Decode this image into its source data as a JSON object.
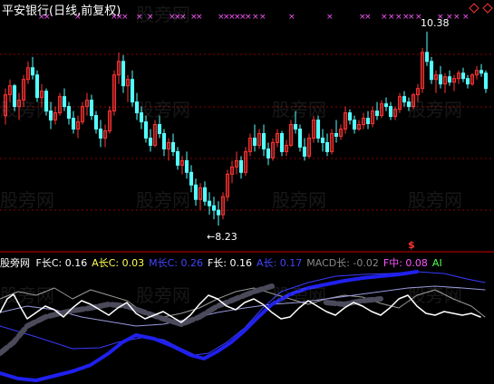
{
  "title": "平安银行(日线,前复权)",
  "annotations": {
    "high": "10.38",
    "low": "8.23",
    "low_arrow": "←8.23"
  },
  "watermark": "股旁网",
  "signal_mark": "$",
  "legend": {
    "prefix": "股旁网",
    "items": [
      {
        "label": "F长C:",
        "value": "0.16",
        "color": "#ffffff"
      },
      {
        "label": "A长C:",
        "value": "0.03",
        "color": "#ffff55"
      },
      {
        "label": "M长C:",
        "value": "0.26",
        "color": "#4444ff"
      },
      {
        "label": "F长:",
        "value": "0.16",
        "color": "#ffffff"
      },
      {
        "label": "A长:",
        "value": "0.17",
        "color": "#4444ff"
      },
      {
        "label": "MACD长:",
        "value": "-0.02",
        "color": "#888888"
      },
      {
        "label": "F中:",
        "value": "0.08",
        "color": "#ff55ff"
      },
      {
        "label": "AI",
        "value": "",
        "color": "#55ff55"
      }
    ]
  },
  "colors": {
    "up": "#ff3333",
    "down": "#55ffff",
    "grid": "#8b0000",
    "marker": "#ff55ff",
    "divider": "#cc0000"
  },
  "chart_data": {
    "type": "candlestick",
    "y_range": [
      8.0,
      10.55
    ],
    "candles": [
      [
        9.45,
        9.75,
        9.35,
        9.68
      ],
      [
        9.68,
        9.85,
        9.6,
        9.78
      ],
      [
        9.78,
        9.8,
        9.5,
        9.55
      ],
      [
        9.55,
        9.7,
        9.4,
        9.62
      ],
      [
        9.62,
        9.9,
        9.55,
        9.85
      ],
      [
        9.85,
        10.05,
        9.8,
        9.98
      ],
      [
        9.98,
        10.1,
        9.85,
        9.9
      ],
      [
        9.9,
        9.95,
        9.6,
        9.65
      ],
      [
        9.65,
        9.8,
        9.55,
        9.72
      ],
      [
        9.72,
        9.75,
        9.45,
        9.5
      ],
      [
        9.5,
        9.6,
        9.3,
        9.4
      ],
      [
        9.4,
        9.55,
        9.35,
        9.48
      ],
      [
        9.48,
        9.7,
        9.45,
        9.66
      ],
      [
        9.66,
        9.75,
        9.5,
        9.55
      ],
      [
        9.55,
        9.6,
        9.35,
        9.42
      ],
      [
        9.42,
        9.5,
        9.25,
        9.3
      ],
      [
        9.3,
        9.45,
        9.2,
        9.38
      ],
      [
        9.38,
        9.6,
        9.35,
        9.55
      ],
      [
        9.55,
        9.7,
        9.45,
        9.62
      ],
      [
        9.62,
        9.68,
        9.4,
        9.45
      ],
      [
        9.45,
        9.5,
        9.25,
        9.3
      ],
      [
        9.3,
        9.4,
        9.1,
        9.2
      ],
      [
        9.2,
        9.35,
        9.1,
        9.28
      ],
      [
        9.28,
        9.55,
        9.25,
        9.5
      ],
      [
        9.5,
        9.95,
        9.45,
        9.9
      ],
      [
        9.9,
        10.15,
        9.8,
        10.05
      ],
      [
        10.05,
        10.12,
        9.7,
        9.78
      ],
      [
        9.78,
        9.9,
        9.6,
        9.85
      ],
      [
        9.85,
        9.95,
        9.55,
        9.6
      ],
      [
        9.6,
        9.7,
        9.4,
        9.48
      ],
      [
        9.48,
        9.55,
        9.3,
        9.38
      ],
      [
        9.38,
        9.45,
        9.15,
        9.2
      ],
      [
        9.2,
        9.3,
        9.05,
        9.12
      ],
      [
        9.12,
        9.4,
        9.1,
        9.35
      ],
      [
        9.35,
        9.45,
        9.2,
        9.25
      ],
      [
        9.25,
        9.3,
        9.0,
        9.08
      ],
      [
        9.08,
        9.2,
        8.95,
        9.15
      ],
      [
        9.15,
        9.25,
        9.0,
        9.05
      ],
      [
        9.05,
        9.1,
        8.85,
        8.9
      ],
      [
        8.9,
        9.0,
        8.8,
        8.95
      ],
      [
        8.95,
        9.05,
        8.75,
        8.82
      ],
      [
        8.82,
        8.9,
        8.6,
        8.68
      ],
      [
        8.68,
        8.75,
        8.45,
        8.52
      ],
      [
        8.52,
        8.7,
        8.4,
        8.65
      ],
      [
        8.65,
        8.72,
        8.45,
        8.5
      ],
      [
        8.5,
        8.6,
        8.35,
        8.45
      ],
      [
        8.45,
        8.55,
        8.3,
        8.4
      ],
      [
        8.4,
        8.5,
        8.23,
        8.35
      ],
      [
        8.35,
        8.6,
        8.3,
        8.55
      ],
      [
        8.55,
        8.85,
        8.5,
        8.8
      ],
      [
        8.8,
        8.95,
        8.7,
        8.88
      ],
      [
        8.88,
        9.05,
        8.8,
        8.95
      ],
      [
        8.95,
        9.0,
        8.75,
        8.82
      ],
      [
        8.82,
        9.1,
        8.78,
        9.05
      ],
      [
        9.05,
        9.25,
        9.0,
        9.2
      ],
      [
        9.2,
        9.35,
        9.05,
        9.12
      ],
      [
        9.12,
        9.3,
        9.08,
        9.25
      ],
      [
        9.25,
        9.35,
        9.0,
        9.08
      ],
      [
        9.08,
        9.15,
        8.9,
        8.98
      ],
      [
        8.98,
        9.2,
        8.95,
        9.15
      ],
      [
        9.15,
        9.3,
        9.1,
        9.25
      ],
      [
        9.25,
        9.28,
        9.0,
        9.05
      ],
      [
        9.05,
        9.18,
        9.0,
        9.12
      ],
      [
        9.12,
        9.4,
        9.1,
        9.35
      ],
      [
        9.35,
        9.5,
        9.25,
        9.3
      ],
      [
        9.3,
        9.35,
        9.05,
        9.1
      ],
      [
        9.1,
        9.2,
        8.95,
        9.0
      ],
      [
        9.0,
        9.25,
        8.98,
        9.2
      ],
      [
        9.2,
        9.45,
        9.15,
        9.4
      ],
      [
        9.4,
        9.45,
        9.15,
        9.2
      ],
      [
        9.2,
        9.3,
        9.05,
        9.15
      ],
      [
        9.15,
        9.25,
        9.0,
        9.05
      ],
      [
        9.05,
        9.3,
        9.02,
        9.25
      ],
      [
        9.25,
        9.4,
        9.15,
        9.22
      ],
      [
        9.22,
        9.35,
        9.18,
        9.3
      ],
      [
        9.3,
        9.55,
        9.25,
        9.48
      ],
      [
        9.48,
        9.52,
        9.35,
        9.4
      ],
      [
        9.4,
        9.45,
        9.25,
        9.3
      ],
      [
        9.3,
        9.4,
        9.28,
        9.35
      ],
      [
        9.35,
        9.48,
        9.3,
        9.42
      ],
      [
        9.42,
        9.5,
        9.3,
        9.36
      ],
      [
        9.36,
        9.55,
        9.32,
        9.5
      ],
      [
        9.5,
        9.6,
        9.4,
        9.45
      ],
      [
        9.45,
        9.62,
        9.42,
        9.58
      ],
      [
        9.58,
        9.65,
        9.5,
        9.55
      ],
      [
        9.55,
        9.6,
        9.4,
        9.44
      ],
      [
        9.44,
        9.55,
        9.4,
        9.52
      ],
      [
        9.52,
        9.7,
        9.48,
        9.66
      ],
      [
        9.66,
        9.72,
        9.55,
        9.6
      ],
      [
        9.6,
        9.65,
        9.5,
        9.55
      ],
      [
        9.55,
        9.7,
        9.52,
        9.68
      ],
      [
        9.68,
        9.8,
        9.6,
        9.75
      ],
      [
        9.75,
        10.2,
        9.7,
        10.15
      ],
      [
        10.15,
        10.38,
        10.0,
        10.05
      ],
      [
        10.05,
        10.1,
        9.8,
        9.85
      ],
      [
        9.85,
        9.95,
        9.7,
        9.9
      ],
      [
        9.9,
        10.0,
        9.75,
        9.8
      ],
      [
        9.8,
        9.92,
        9.7,
        9.88
      ],
      [
        9.88,
        9.95,
        9.78,
        9.82
      ],
      [
        9.82,
        9.9,
        9.72,
        9.86
      ],
      [
        9.86,
        9.95,
        9.8,
        9.92
      ],
      [
        9.92,
        9.98,
        9.82,
        9.86
      ],
      [
        9.86,
        9.9,
        9.75,
        9.8
      ],
      [
        9.8,
        9.92,
        9.78,
        9.9
      ],
      [
        9.9,
        10.0,
        9.85,
        9.95
      ],
      [
        9.95,
        10.02,
        9.88,
        9.92
      ],
      [
        9.92,
        9.95,
        9.7,
        9.75
      ]
    ],
    "indicators": [
      {
        "name": "F长C",
        "value": 0.16
      },
      {
        "name": "A长C",
        "value": 0.03
      },
      {
        "name": "M长C",
        "value": 0.26
      },
      {
        "name": "F长",
        "value": 0.16
      },
      {
        "name": "A长",
        "value": 0.17
      },
      {
        "name": "MACD长",
        "value": -0.02
      },
      {
        "name": "F中",
        "value": 0.08
      }
    ]
  }
}
